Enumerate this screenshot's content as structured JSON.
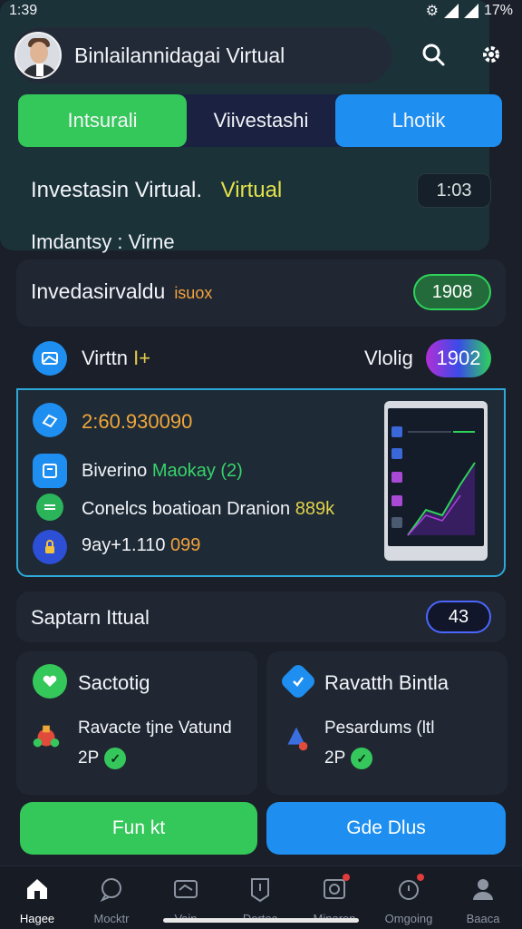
{
  "status": {
    "time": "1:39",
    "battery": "17%"
  },
  "header": {
    "title": "Binlailannidagai Virtual",
    "search_icon": "search-icon",
    "settings_icon": "gear-icon"
  },
  "tabs": [
    {
      "label": "Intsurali"
    },
    {
      "label": "Viivestashi"
    },
    {
      "label": "Lhotik"
    }
  ],
  "section": {
    "title": "Investasin Virtual.",
    "accent": "Virtual",
    "time": "1:03"
  },
  "subtitle": "Imdantsy : Virne",
  "card_a": {
    "title": "Invedasirvaldu",
    "tag": "isuox",
    "pill": "1908"
  },
  "card_b": {
    "header_label": "Virttn",
    "header_plus": "I+",
    "header_right": "Vlolig",
    "header_pill": "1902",
    "rows": [
      {
        "text": "2:60.930090"
      },
      {
        "prefix": "Biverino ",
        "accent": "Maokay (2)"
      },
      {
        "prefix": "Conelcs boatioan Dranion ",
        "accent": "889k"
      },
      {
        "prefix": "9ay+1.110 ",
        "accent": "099"
      }
    ]
  },
  "card_c": {
    "title": "Saptarn  Ittual",
    "badge": "43"
  },
  "mini_cards": [
    {
      "title": "Sactotig",
      "line1": "Ravacte tjne Vatund",
      "line2": "2P"
    },
    {
      "title": "Ravatth Bintla",
      "line1": "Pesardums (ltl",
      "line2": "2P"
    }
  ],
  "buttons": {
    "primary": "Fun kt",
    "secondary": "Gde Dlus"
  },
  "nav": [
    {
      "label": "Hagee",
      "icon": "home-icon"
    },
    {
      "label": "Mocktr",
      "icon": "chat-icon"
    },
    {
      "label": "Vain",
      "icon": "wallet-icon"
    },
    {
      "label": "Dortec",
      "icon": "clock-icon"
    },
    {
      "label": "Minaren",
      "icon": "gift-icon"
    },
    {
      "label": "Omgoing",
      "icon": "alarm-icon"
    },
    {
      "label": "Baaca",
      "icon": "profile-icon"
    }
  ],
  "colors": {
    "green": "#34c759",
    "blue": "#1e8ff0",
    "bg": "#1a1f2a",
    "accent_yellow": "#e3e24a"
  }
}
